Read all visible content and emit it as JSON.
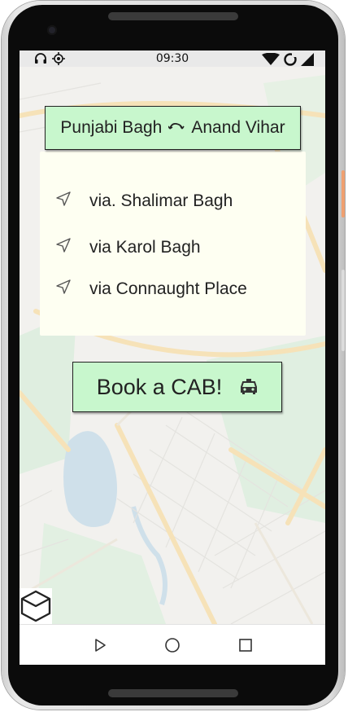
{
  "status_bar": {
    "time": "09:30",
    "left_icons": [
      "headphones-icon",
      "location-icon"
    ],
    "right_icons": [
      "wifi-icon",
      "sync-icon",
      "signal-icon"
    ]
  },
  "route": {
    "from": "Punjabi Bagh",
    "to": "Anand Vihar",
    "swap_icon": "swap-icon"
  },
  "route_options": [
    {
      "label": "via. Shalimar Bagh",
      "icon": "navigation-icon"
    },
    {
      "label": "via Karol Bagh",
      "icon": "navigation-icon"
    },
    {
      "label": "via Connaught Place",
      "icon": "navigation-icon"
    }
  ],
  "book_button": {
    "label": "Book a CAB!",
    "icon": "taxi-icon"
  },
  "navbar": {
    "icons": [
      "back-triangle-icon",
      "home-circle-icon",
      "recents-square-icon"
    ]
  },
  "colors": {
    "accent": "#c8f7cd",
    "panel": "#fefff2",
    "side_button": "#f0a070"
  }
}
